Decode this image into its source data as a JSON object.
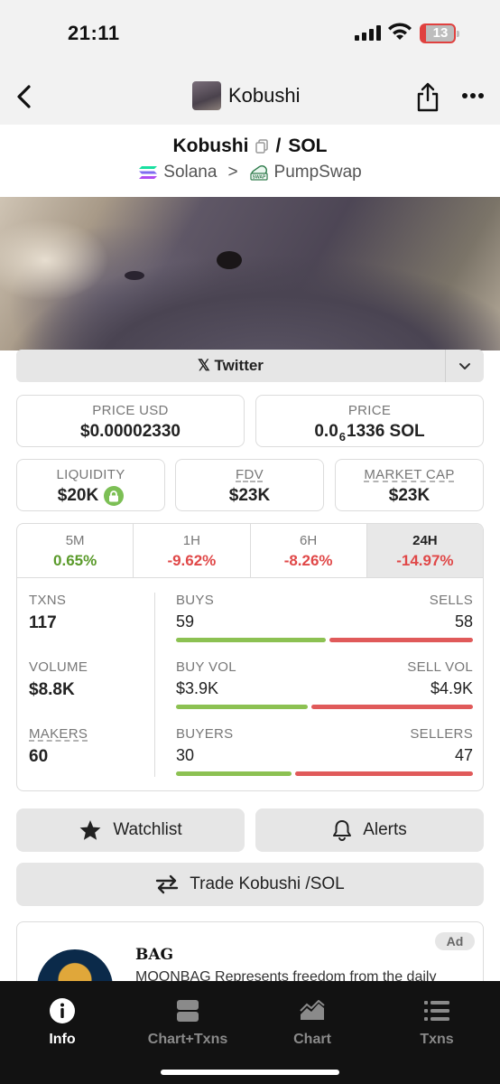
{
  "status": {
    "time": "21:11",
    "battery": "13"
  },
  "nav": {
    "title": "Kobushi"
  },
  "pair": {
    "base": "Kobushi",
    "sep": "/",
    "quote": "SOL",
    "chain": "Solana",
    "arrow": ">",
    "dex": "PumpSwap"
  },
  "twitter": {
    "label": "𝕏 Twitter"
  },
  "price": {
    "usd_label": "PRICE USD",
    "usd_value": "$0.00002330",
    "native_label": "PRICE",
    "native_prefix": "0.0",
    "native_sub": "6",
    "native_suffix": "1336 SOL"
  },
  "metrics": {
    "liquidity_label": "LIQUIDITY",
    "liquidity_value": "$20K",
    "fdv_label": "FDV",
    "fdv_value": "$23K",
    "mcap_label": "MARKET CAP",
    "mcap_value": "$23K"
  },
  "timeframes": [
    {
      "label": "5M",
      "pct": "0.65%"
    },
    {
      "label": "1H",
      "pct": "-9.62%"
    },
    {
      "label": "6H",
      "pct": "-8.26%"
    },
    {
      "label": "24H",
      "pct": "-14.97%"
    }
  ],
  "stats": {
    "txns_label": "TXNS",
    "txns_value": "117",
    "volume_label": "VOLUME",
    "volume_value": "$8.8K",
    "makers_label": "MAKERS",
    "makers_value": "60",
    "buys_label": "BUYS",
    "buys_value": "59",
    "sells_label": "SELLS",
    "sells_value": "58",
    "buys_fraction": 0.504,
    "buyvol_label": "BUY VOL",
    "buyvol_value": "$3.9K",
    "sellvol_label": "SELL VOL",
    "sellvol_value": "$4.9K",
    "buyvol_fraction": 0.443,
    "buyers_label": "BUYERS",
    "buyers_value": "30",
    "sellers_label": "SELLERS",
    "sellers_value": "47",
    "buyers_fraction": 0.39
  },
  "actions": {
    "watchlist": "Watchlist",
    "alerts": "Alerts",
    "trade": "Trade Kobushi /SOL"
  },
  "ad": {
    "name": "BAG",
    "desc": "MOONBAG Represents freedom from the daily",
    "badge": "Ad"
  },
  "tabbar": {
    "info": "Info",
    "chart_txns": "Chart+Txns",
    "chart": "Chart",
    "txns": "Txns"
  },
  "colors": {
    "positive": "#5a9a2a",
    "negative": "#e04848",
    "buy_bar": "#8cc152",
    "sell_bar": "#e05a5a"
  }
}
